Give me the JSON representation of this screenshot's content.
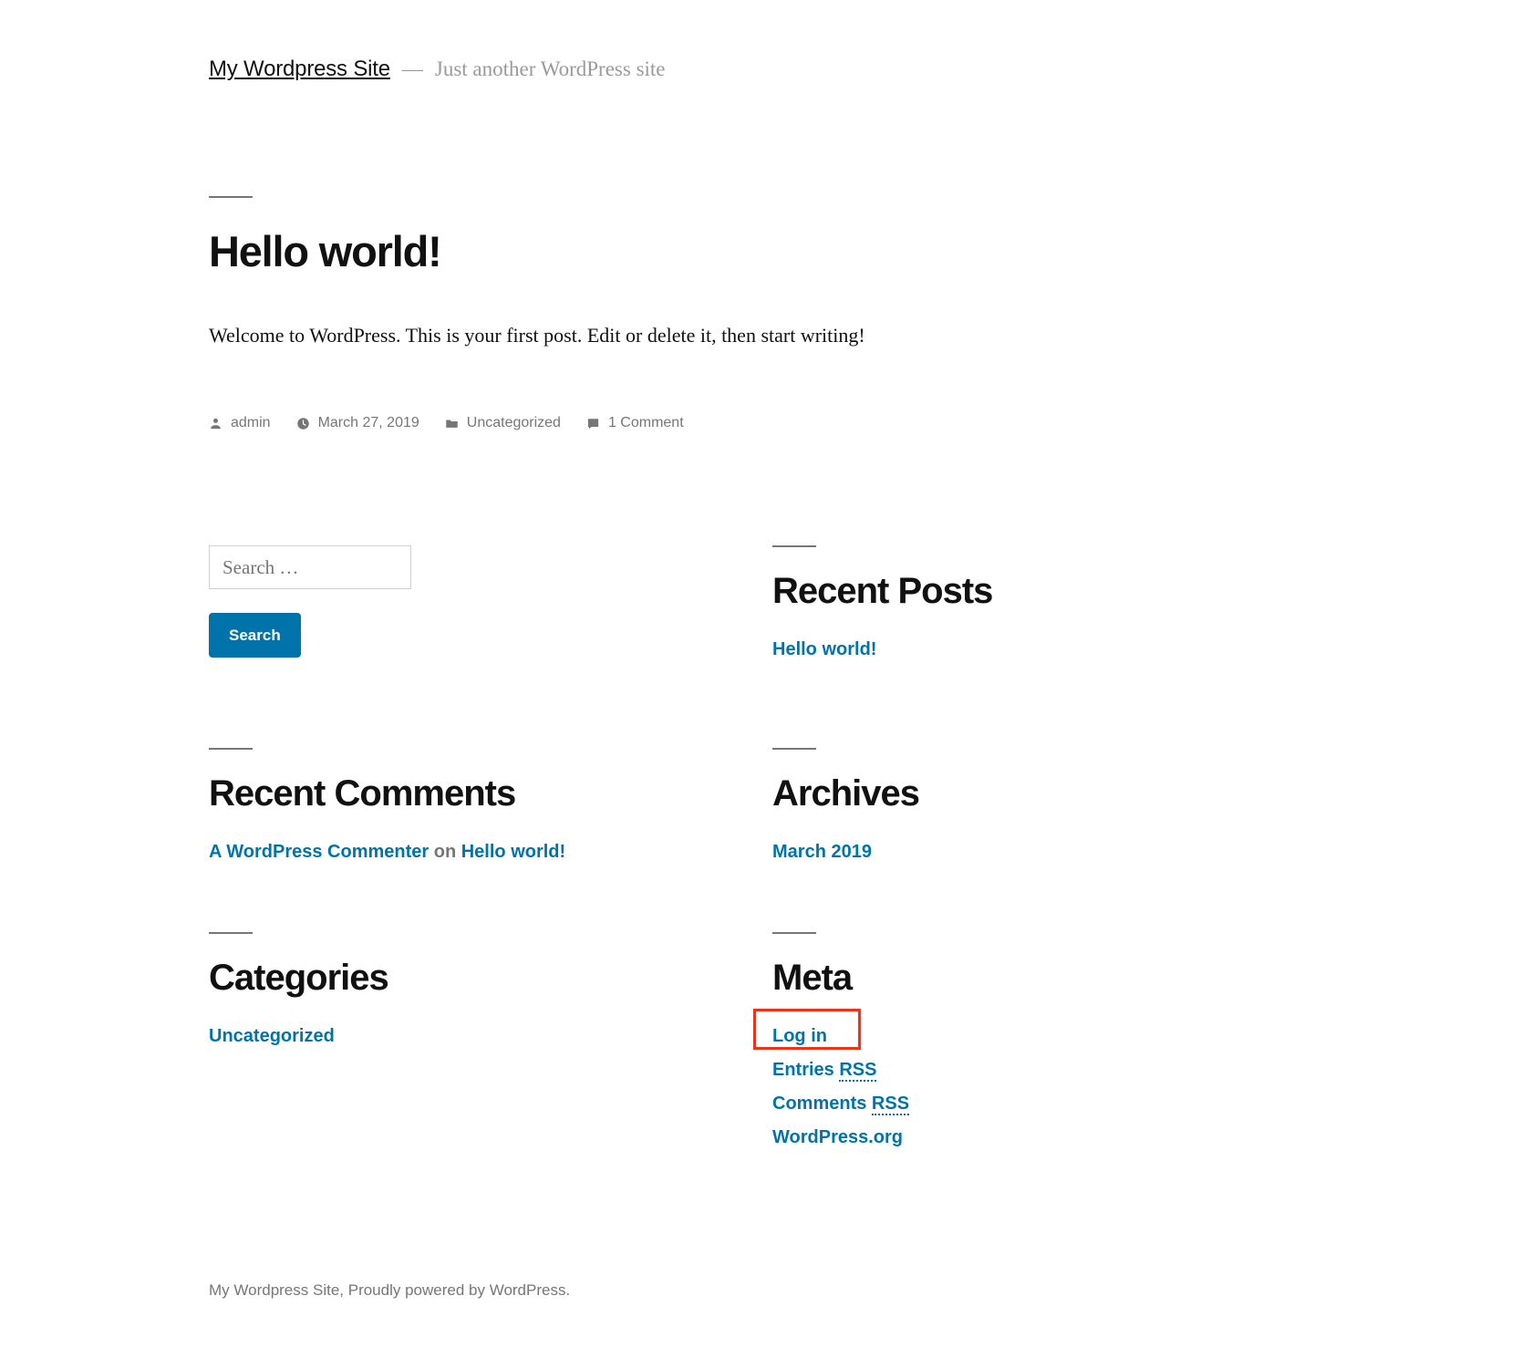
{
  "site": {
    "title": "My Wordpress Site",
    "separator": "—",
    "tagline": "Just another WordPress site"
  },
  "post": {
    "title": "Hello world!",
    "content": "Welcome to WordPress. This is your first post. Edit or delete it, then start writing!",
    "meta": {
      "author_icon": "person-icon",
      "author": "admin",
      "date_icon": "clock-icon",
      "date": "March 27, 2019",
      "category_icon": "folder-icon",
      "category": "Uncategorized",
      "comments_icon": "comment-icon",
      "comments": "1 Comment"
    }
  },
  "search": {
    "placeholder": "Search …",
    "value": "",
    "submit_label": "Search",
    "button_color": "#0073aa"
  },
  "widgets": {
    "recent_posts": {
      "title": "Recent Posts",
      "items": [
        {
          "label": "Hello world!"
        }
      ]
    },
    "recent_comments": {
      "title": "Recent Comments",
      "items": [
        {
          "author": "A WordPress Commenter",
          "connector": "on",
          "post": "Hello world!"
        }
      ]
    },
    "archives": {
      "title": "Archives",
      "items": [
        {
          "label": "March 2019"
        }
      ]
    },
    "categories": {
      "title": "Categories",
      "items": [
        {
          "label": "Uncategorized"
        }
      ]
    },
    "meta": {
      "title": "Meta",
      "items": [
        {
          "label": "Log in",
          "highlighted": true
        },
        {
          "prefix": "Entries ",
          "abbr": "RSS"
        },
        {
          "prefix": "Comments ",
          "abbr": "RSS"
        },
        {
          "label": "WordPress.org"
        }
      ]
    }
  },
  "footer": {
    "text": "My Wordpress Site, Proudly powered by WordPress."
  },
  "colors": {
    "link": "#0073aa",
    "text": "#111111",
    "muted": "#767676",
    "highlight": "#fc2e12"
  }
}
